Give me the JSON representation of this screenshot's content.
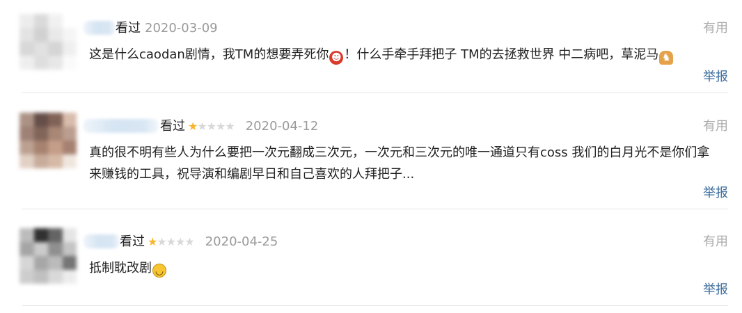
{
  "comments": [
    {
      "status": "看过",
      "rating": 0,
      "show_stars": false,
      "date": "2020-03-09",
      "useful_label": "有用",
      "text_parts": [
        "这是什么caodan剧情，我TM的想要弄死你",
        "！什么手牵手拜把子 TM的去拯救世界 中二病吧，草泥马"
      ],
      "emojis": [
        "devil-emoji",
        "horse-emoji"
      ],
      "report_label": "举报"
    },
    {
      "status": "看过",
      "rating": 1,
      "show_stars": true,
      "date": "2020-04-12",
      "useful_label": "有用",
      "text": "真的很不明有些人为什么要把一次元翻成三次元，一次元和三次元的唯一通道只有coss 我们的白月光不是你们拿来赚钱的工具，祝导演和编剧早日和自己喜欢的人拜把子...",
      "report_label": "举报"
    },
    {
      "status": "看过",
      "rating": 1,
      "show_stars": true,
      "date": "2020-04-25",
      "useful_label": "有用",
      "text": "抵制耽改剧",
      "emojis": [
        "smile-emoji"
      ],
      "report_label": "举报"
    }
  ],
  "colors": {
    "star_on": "#f7b52c",
    "star_off": "#d8d8d8",
    "date": "#9a9a9a",
    "useful": "#aaaaaa",
    "report": "#3d6e9e",
    "divider": "#e4e4e4"
  }
}
